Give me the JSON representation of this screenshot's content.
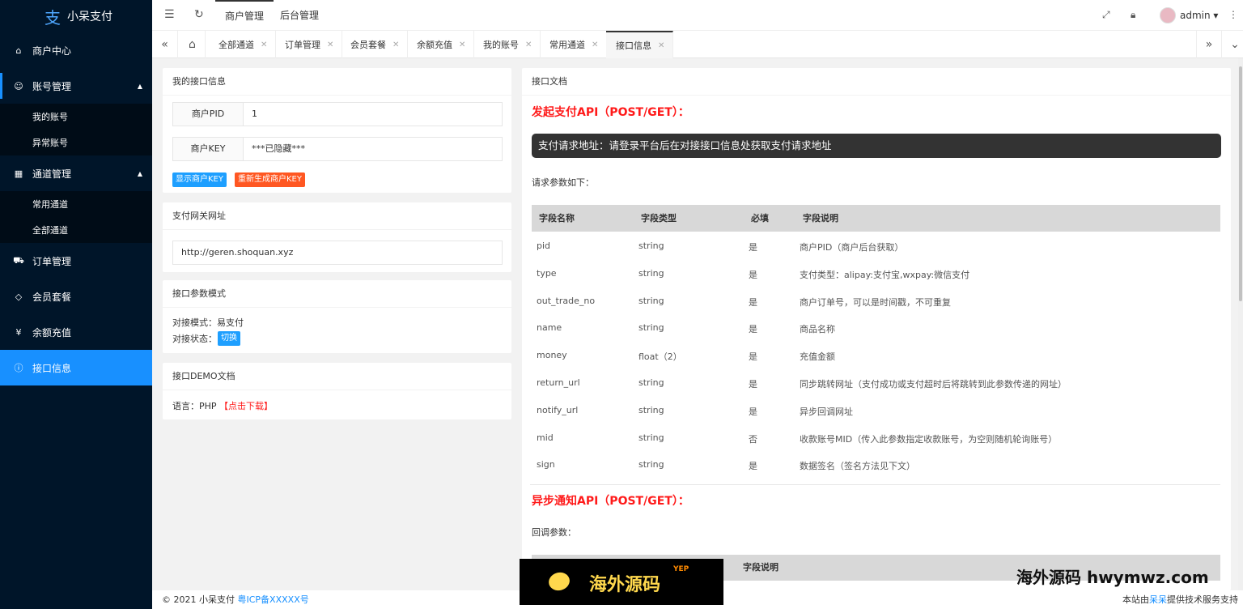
{
  "app": {
    "logo_glyph": "支",
    "title": "小呆支付"
  },
  "sidebar": {
    "items": [
      {
        "label": "商户中心",
        "icon": "home-icon"
      },
      {
        "label": "账号管理",
        "icon": "user-icon",
        "children": [
          "我的账号",
          "异常账号"
        ]
      },
      {
        "label": "通道管理",
        "icon": "apps-icon",
        "children": [
          "常用通道",
          "全部通道"
        ]
      },
      {
        "label": "订单管理",
        "icon": "cart-icon"
      },
      {
        "label": "会员套餐",
        "icon": "diamond-icon"
      },
      {
        "label": "余额充值",
        "icon": "yen-icon"
      },
      {
        "label": "接口信息",
        "icon": "info-icon",
        "active": true
      }
    ]
  },
  "header": {
    "menus": [
      "商户管理",
      "后台管理"
    ],
    "user": "admin"
  },
  "tabs": [
    "全部通道",
    "订单管理",
    "会员套餐",
    "余额充值",
    "我的账号",
    "常用通道",
    "接口信息"
  ],
  "left": {
    "my_info": {
      "title": "我的接口信息",
      "pid_label": "商户PID",
      "pid_value": "1",
      "key_label": "商户KEY",
      "key_value": "***已隐藏***",
      "show_key_btn": "显示商户KEY",
      "regen_key_btn": "重新生成商户KEY"
    },
    "gateway": {
      "title": "支付网关网址",
      "url": "http://geren.shoquan.xyz"
    },
    "mode": {
      "title": "接口参数模式",
      "mode_line": "对接模式：易支付",
      "status_label": "对接状态：",
      "switch_btn": "切换"
    },
    "demo": {
      "title": "接口DEMO文档",
      "lang_label": "语言：PHP",
      "download": "【点击下载】"
    }
  },
  "doc": {
    "title": "接口文档",
    "pay_api_title": "发起支付API（POST/GET）：",
    "request_url_note": "支付请求地址：请登录平台后在对接接口信息处获取支付请求地址",
    "params_intro": "请求参数如下：",
    "columns": [
      "字段名称",
      "字段类型",
      "必填",
      "字段说明"
    ],
    "rows": [
      [
        "pid",
        "string",
        "是",
        "商户PID（商户后台获取）"
      ],
      [
        "type",
        "string",
        "是",
        "支付类型：alipay:支付宝,wxpay:微信支付"
      ],
      [
        "out_trade_no",
        "string",
        "是",
        "商户订单号，可以是时间戳，不可重复"
      ],
      [
        "name",
        "string",
        "是",
        "商品名称"
      ],
      [
        "money",
        "float（2）",
        "是",
        "充值金额"
      ],
      [
        "return_url",
        "string",
        "是",
        "同步跳转网址（支付成功或支付超时后将跳转到此参数传递的网址）"
      ],
      [
        "notify_url",
        "string",
        "是",
        "异步回调网址"
      ],
      [
        "mid",
        "string",
        "否",
        "收款账号MID（传入此参数指定收款账号，为空则随机轮询账号）"
      ],
      [
        "sign",
        "string",
        "是",
        "数据签名（签名方法见下文）"
      ]
    ],
    "notify_api_title": "异步通知API（POST/GET）：",
    "callback_intro": "回调参数：",
    "callback_col": "字段说明"
  },
  "footer": {
    "copyright": "© 2021 小呆支付",
    "icp": "粤ICP备XXXXX号",
    "support_prefix": "本站由",
    "support_link": "呆呆",
    "support_suffix": "提供技术服务支持"
  },
  "watermarks": {
    "badge": "海外源码",
    "tag": "YEP",
    "text": "海外源码 hwymwz.com"
  }
}
